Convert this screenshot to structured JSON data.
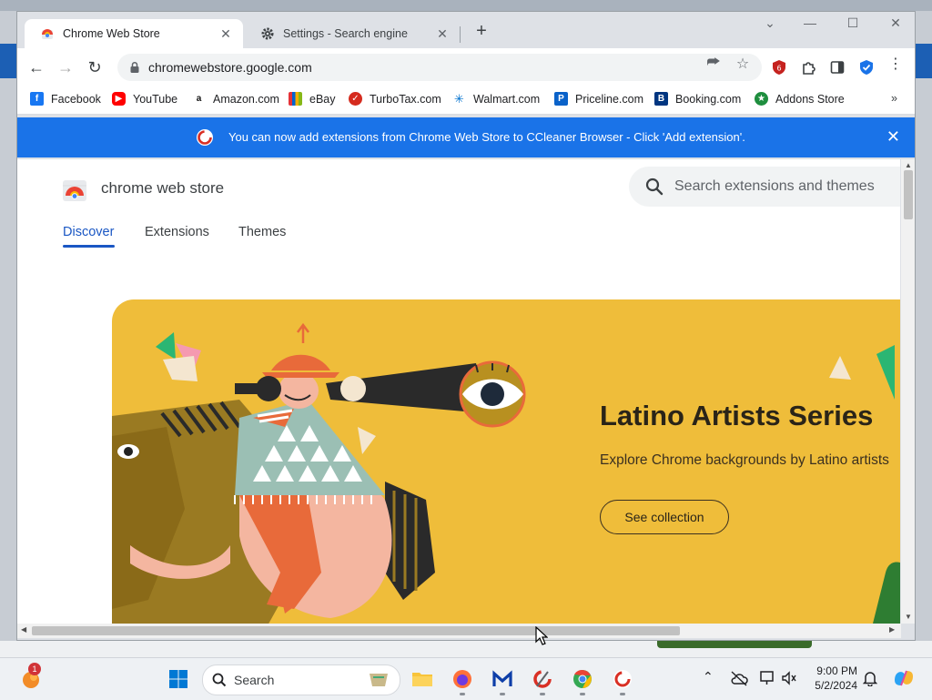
{
  "browser": {
    "tabs": [
      {
        "title": "Chrome Web Store",
        "active": true
      },
      {
        "title": "Settings - Search engine",
        "active": false
      }
    ],
    "url": "chromewebstore.google.com",
    "bookmarks": [
      {
        "label": "Facebook"
      },
      {
        "label": "YouTube"
      },
      {
        "label": "Amazon.com"
      },
      {
        "label": "eBay"
      },
      {
        "label": "TurboTax.com"
      },
      {
        "label": "Walmart.com"
      },
      {
        "label": "Priceline.com"
      },
      {
        "label": "Booking.com"
      },
      {
        "label": "Addons Store"
      }
    ],
    "bookmarks_overflow": "»",
    "infobar": {
      "message": "You can now add extensions from Chrome Web Store to CCleaner Browser - Click 'Add extension'."
    },
    "ext_badge": "6"
  },
  "page": {
    "store_name": "chrome web store",
    "search_placeholder": "Search extensions and themes",
    "nav": [
      "Discover",
      "Extensions",
      "Themes"
    ],
    "hero": {
      "title": "Latino Artists Series",
      "subtitle": "Explore Chrome backgrounds by Latino artists",
      "button": "See collection"
    }
  },
  "taskbar": {
    "search_placeholder": "Search",
    "notification_count": "1",
    "time": "9:00 PM",
    "date": "5/2/2024"
  },
  "colors": {
    "accent": "#1a73e8",
    "nav_active": "#1a57c4",
    "hero_bg": "#efbd3a"
  }
}
